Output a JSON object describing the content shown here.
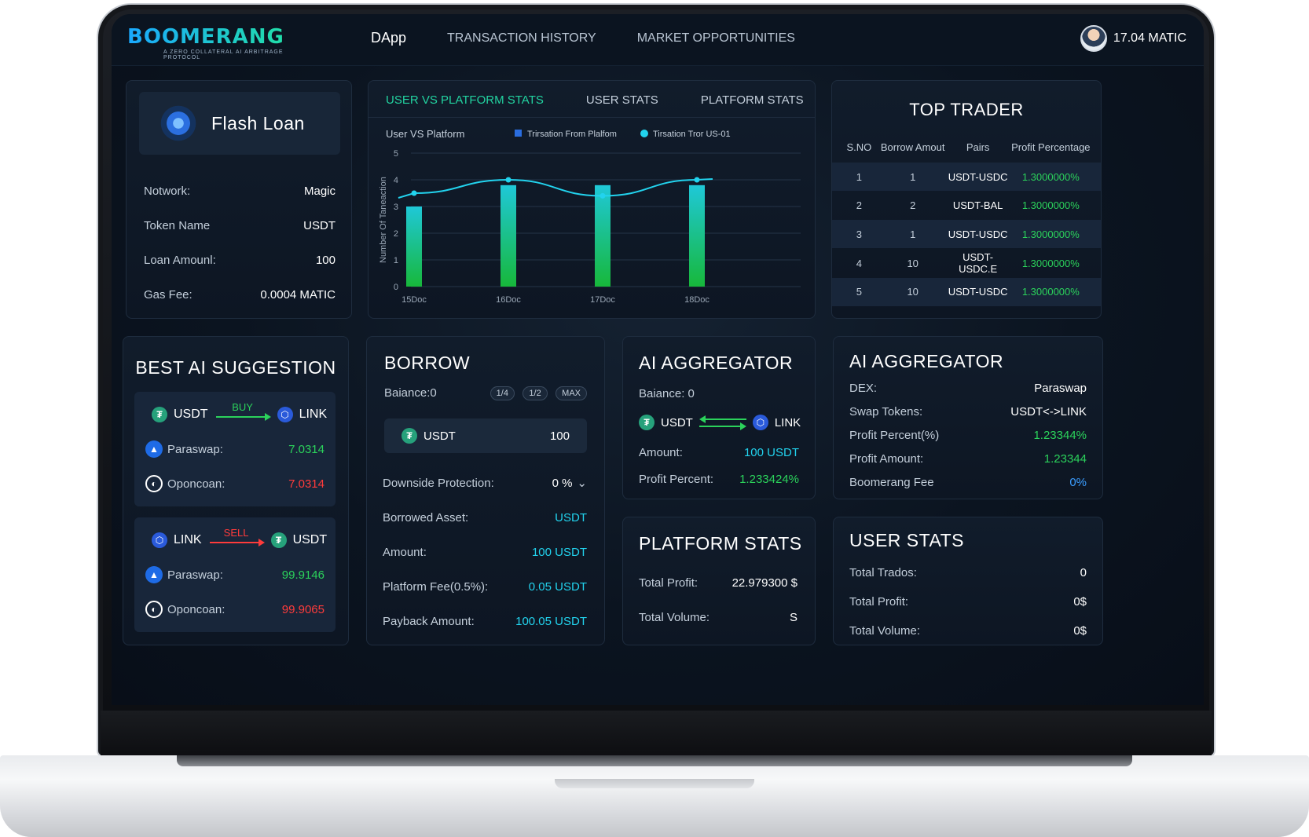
{
  "header": {
    "logo_text": "BOOMERANG",
    "logo_sub": "A ZERO COLLATERAL AI ARBITRAGE PROTOCOL",
    "nav": [
      "DApp",
      "TRANSACTION HISTORY",
      "MARKET OPPORTUNITIES"
    ],
    "balance": "17.04 MATIC"
  },
  "flash_loan": {
    "title": "Flash Loan",
    "rows": [
      {
        "label": "Notwork:",
        "value": "Magic"
      },
      {
        "label": "Token Name",
        "value": "USDT"
      },
      {
        "label": "Loan Amounl:",
        "value": "100"
      },
      {
        "label": "Gas Fee:",
        "value": "0.0004 MATIC"
      }
    ]
  },
  "stats_tabs": [
    "USER VS PLATFORM STATS",
    "USER STATS",
    "PLATFORM STATS"
  ],
  "chart_data": {
    "type": "bar",
    "title": "User VS Platform",
    "ylabel": "Number Of Taneaction",
    "categories": [
      "15Doc",
      "16Doc",
      "17Doc",
      "18Doc"
    ],
    "series": [
      {
        "name": "Trirsation From Plalfom",
        "type": "bar",
        "values": [
          3.0,
          3.8,
          3.8,
          3.8
        ]
      },
      {
        "name": "Tirsation Tror US-01",
        "type": "line",
        "values": [
          3.5,
          4.0,
          3.4,
          4.0
        ]
      }
    ],
    "ylim": [
      0,
      5
    ],
    "yticks": [
      "0",
      "1",
      "2",
      "3",
      "4",
      "5"
    ],
    "grid": true,
    "legend": "top"
  },
  "top_trader": {
    "title": "TOP TRADER",
    "columns": [
      "S.NO",
      "Borrow Amout",
      "Pairs",
      "Profit Percentage"
    ],
    "rows": [
      [
        "1",
        "1",
        "USDT-USDC",
        "1.3000000%"
      ],
      [
        "2",
        "2",
        "USDT-BAL",
        "1.3000000%"
      ],
      [
        "3",
        "1",
        "USDT-USDC",
        "1.3000000%"
      ],
      [
        "4",
        "10",
        "USDT-USDC.E",
        "1.3000000%"
      ],
      [
        "5",
        "10",
        "USDT-USDC",
        "1.3000000%"
      ]
    ]
  },
  "best_ai": {
    "title": "BEST AI SUGGESTION",
    "buy": {
      "from": "USDT",
      "action": "BUY",
      "to": "LINK",
      "dex1": "Paraswap:",
      "val1": "7.0314",
      "dex2": "Oponcoan:",
      "val2": "7.0314"
    },
    "sell": {
      "from": "LINK",
      "action": "SELL",
      "to": "USDT",
      "dex1": "Paraswap:",
      "val1": "99.9146",
      "dex2": "Oponcoan:",
      "val2": "99.9065"
    }
  },
  "borrow": {
    "title": "BORROW",
    "balance": "Baiance:0",
    "pills": [
      "1/4",
      "1/2",
      "MAX"
    ],
    "token": "USDT",
    "amount": "100",
    "rows": [
      {
        "label": "Downside Protection:",
        "value": "0  %"
      },
      {
        "label": "Borrowed Asset:",
        "value": "USDT"
      },
      {
        "label": "Amount:",
        "value": "100 USDT"
      },
      {
        "label": "Platform Fee(0.5%):",
        "value": "0.05 USDT"
      },
      {
        "label": "Payback Amount:",
        "value": "100.05 USDT"
      }
    ]
  },
  "ai_agg_1": {
    "title": "AI AGGREGATOR",
    "balance": "Baiance:  0",
    "from": "USDT",
    "to": "LINK",
    "amount_label": "Amount:",
    "amount": "100 USDT",
    "profit_label": "Profit Percent:",
    "profit": "1.233424%"
  },
  "ai_agg_2": {
    "title": "AI AGGREGATOR",
    "rows": [
      {
        "label": "DEX:",
        "value": "Paraswap"
      },
      {
        "label": "Swap Tokens:",
        "value": "USDT<->LINK"
      },
      {
        "label": "Profit Percent(%)",
        "value": "1.23344%"
      },
      {
        "label": "Profit Amount:",
        "value": "1.23344"
      },
      {
        "label": "Boomerang Fee",
        "value": "0%"
      }
    ]
  },
  "platform_stats": {
    "title": "PLATFORM STATS",
    "rows": [
      {
        "label": "Total Profit:",
        "value": "22.979300 $"
      },
      {
        "label": "Total Volume:",
        "value": "S"
      }
    ]
  },
  "user_stats": {
    "title": "USER STATS",
    "rows": [
      {
        "label": "Total Trados:",
        "value": "0"
      },
      {
        "label": "Total Profit:",
        "value": "0$"
      },
      {
        "label": "Total Volume:",
        "value": "0$"
      }
    ]
  },
  "colors": {
    "accent_green": "#2bd25b",
    "accent_cyan": "#22d3ee",
    "loss_red": "#ff3b3b"
  }
}
